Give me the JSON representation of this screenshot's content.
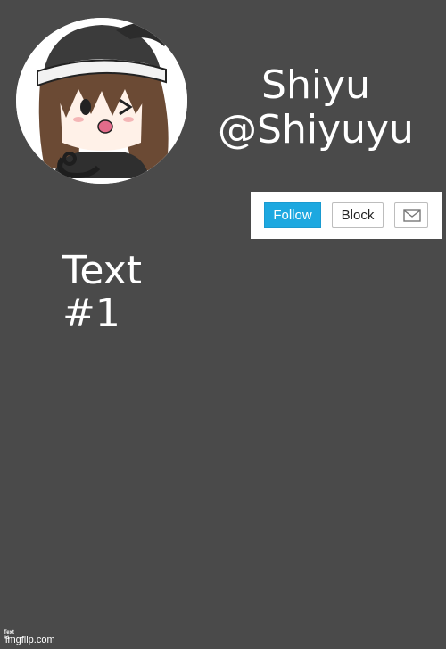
{
  "profile": {
    "display_name": "Shiyu",
    "handle": "@Shiyuyu",
    "avatar_icon": "anime-girl-avatar-icon"
  },
  "actions": {
    "follow_label": "Follow",
    "block_label": "Block",
    "message_icon": "envelope-icon"
  },
  "content": {
    "text": "Text #1",
    "small_text": "Text #1"
  },
  "watermark": "imgflip.com",
  "colors": {
    "background": "#4a4a4a",
    "follow_button": "#1da8e0",
    "text": "#ffffff"
  }
}
